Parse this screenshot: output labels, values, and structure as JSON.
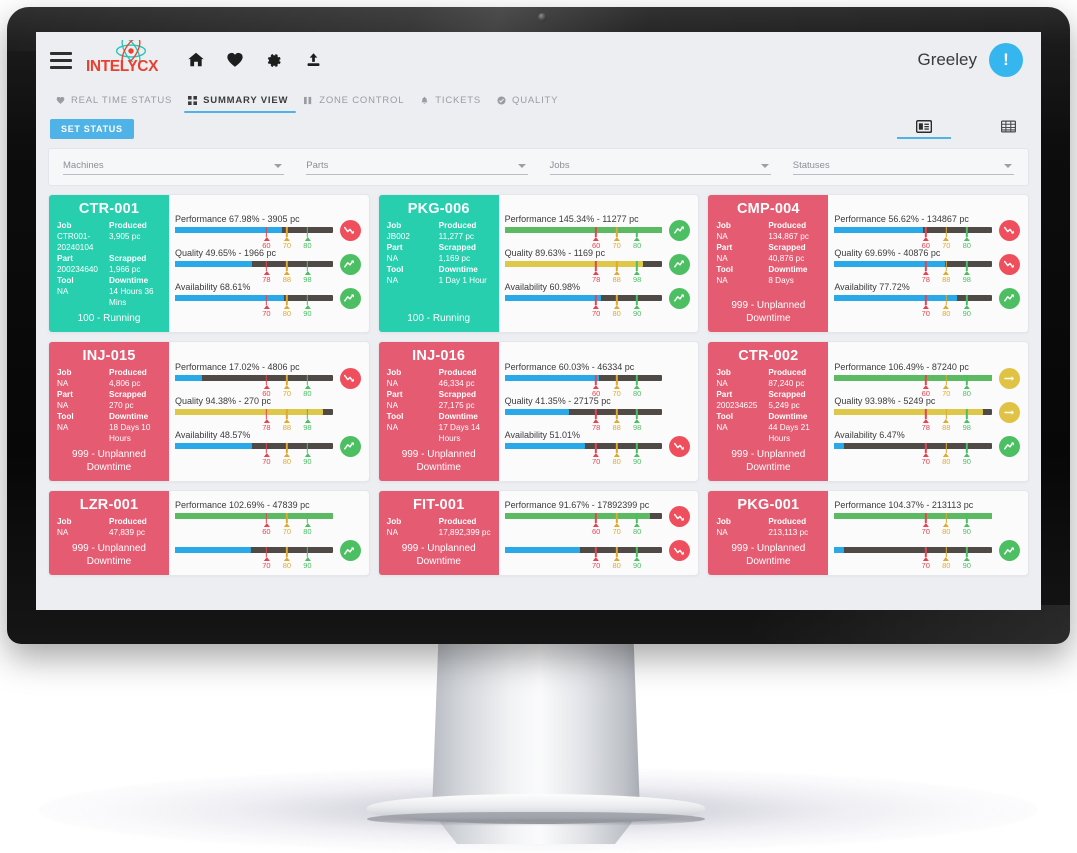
{
  "app": {
    "logo_text": "INTELYCX",
    "user": "Greeley",
    "avatar_glyph": "!",
    "hamburger_icon": "hamburger-menu-icon",
    "nav_icons": [
      {
        "name": "home-icon",
        "glyph": "⌂"
      },
      {
        "name": "heart-icon",
        "glyph": "♥"
      },
      {
        "name": "gear-icon",
        "glyph": "⚙"
      },
      {
        "name": "upload-icon",
        "glyph": "⇧"
      }
    ]
  },
  "tabs": [
    {
      "label": "REAL TIME STATUS",
      "icon": "heart-icon",
      "active": false
    },
    {
      "label": "SUMMARY VIEW",
      "icon": "grid-squares-icon",
      "active": true
    },
    {
      "label": "ZONE CONTROL",
      "icon": "columns-icon",
      "active": false
    },
    {
      "label": "TICKETS",
      "icon": "bell-icon",
      "active": false
    },
    {
      "label": "QUALITY",
      "icon": "check-circle-icon",
      "active": false
    }
  ],
  "subbar": {
    "set_status_label": "SET STATUS",
    "view_toggles": [
      {
        "name": "card-view-icon",
        "active": true
      },
      {
        "name": "table-view-icon",
        "active": false
      }
    ]
  },
  "filters": [
    {
      "label": "Machines",
      "value": ""
    },
    {
      "label": "Parts",
      "value": ""
    },
    {
      "label": "Jobs",
      "value": ""
    },
    {
      "label": "Statuses",
      "value": ""
    }
  ],
  "colors": {
    "accent": "#4fb3e8",
    "running": "#27cfae",
    "downtime": "#e45b72",
    "bar_blue": "#29a9e8",
    "bar_green": "#5bba62",
    "bar_yellow": "#ddc84a",
    "bar_track": "#4f4a46",
    "badge_red": "#ef4f5c",
    "badge_green": "#4cbf63",
    "badge_amber": "#e0c345",
    "tick_red": "#e8434f",
    "tick_amber": "#e0a92f",
    "tick_green": "#4cbf63"
  },
  "labels": {
    "job": "Job",
    "produced": "Produced",
    "part": "Part",
    "scrapped": "Scrapped",
    "tool": "Tool",
    "downtime": "Downtime"
  },
  "cards": [
    {
      "machine": "CTR-001",
      "state": "running",
      "status": "100 - Running",
      "job": "CTR001-20240104",
      "produced": "3,905 pc",
      "part": "200234640",
      "scrapped": "1,966 pc",
      "tool": "NA",
      "downtime_value": "14 Hours 36 Mins",
      "metrics": [
        {
          "title": "Performance 67.98% - 3905 pc",
          "pct": 68,
          "fill": "blue",
          "ticks": [
            60,
            70,
            80
          ],
          "badge": "red",
          "trend": "down"
        },
        {
          "title": "Quality 49.65% - 1966 pc",
          "pct": 49,
          "fill": "blue",
          "ticks": [
            78,
            88,
            98
          ],
          "badge": "green",
          "trend": "up"
        },
        {
          "title": "Availability 68.61%",
          "pct": 69,
          "fill": "blue",
          "ticks": [
            70,
            80,
            90
          ],
          "badge": "green",
          "trend": "up"
        }
      ]
    },
    {
      "machine": "PKG-006",
      "state": "running",
      "status": "100 - Running",
      "job": "JB002",
      "produced": "11,277 pc",
      "part": "NA",
      "scrapped": "1,169 pc",
      "tool": "NA",
      "downtime_value": "1 Day 1 Hour",
      "metrics": [
        {
          "title": "Performance 145.34% - 11277 pc",
          "pct": 100,
          "fill": "green",
          "ticks": [
            60,
            70,
            80
          ],
          "badge": "green",
          "trend": "up"
        },
        {
          "title": "Quality 89.63% - 1169 pc",
          "pct": 88,
          "fill": "yellow",
          "ticks": [
            78,
            88,
            98
          ],
          "badge": "green",
          "trend": "up"
        },
        {
          "title": "Availability 60.98%",
          "pct": 61,
          "fill": "blue",
          "ticks": [
            70,
            80,
            90
          ],
          "badge": "green",
          "trend": "up"
        }
      ]
    },
    {
      "machine": "CMP-004",
      "state": "down",
      "status": "999 - Unplanned Downtime",
      "job": "NA",
      "produced": "134,867 pc",
      "part": "NA",
      "scrapped": "40,876 pc",
      "tool": "NA",
      "downtime_value": "8 Days",
      "metrics": [
        {
          "title": "Performance 56.62% - 134867 pc",
          "pct": 56,
          "fill": "blue",
          "ticks": [
            60,
            70,
            80
          ],
          "badge": "red",
          "trend": "down"
        },
        {
          "title": "Quality 69.69% - 40876 pc",
          "pct": 70,
          "fill": "blue",
          "ticks": [
            78,
            88,
            98
          ],
          "badge": "red",
          "trend": "down"
        },
        {
          "title": "Availability 77.72%",
          "pct": 78,
          "fill": "blue",
          "ticks": [
            70,
            80,
            90
          ],
          "badge": "green",
          "trend": "up"
        }
      ]
    },
    {
      "machine": "INJ-015",
      "state": "down",
      "status": "999 - Unplanned Downtime",
      "job": "NA",
      "produced": "4,806 pc",
      "part": "NA",
      "scrapped": "270 pc",
      "tool": "NA",
      "downtime_value": "18 Days 10 Hours",
      "metrics": [
        {
          "title": "Performance 17.02% - 4806 pc",
          "pct": 17,
          "fill": "blue",
          "ticks": [
            60,
            70,
            80
          ],
          "badge": "red",
          "trend": "down"
        },
        {
          "title": "Quality 94.38% - 270 pc",
          "pct": 94,
          "fill": "yellow",
          "ticks": [
            78,
            88,
            98
          ],
          "badge": "none",
          "trend": "none"
        },
        {
          "title": "Availability 48.57%",
          "pct": 49,
          "fill": "blue",
          "ticks": [
            70,
            80,
            90
          ],
          "badge": "green",
          "trend": "up"
        }
      ]
    },
    {
      "machine": "INJ-016",
      "state": "down",
      "status": "999 - Unplanned Downtime",
      "job": "NA",
      "produced": "46,334 pc",
      "part": "NA",
      "scrapped": "27,175 pc",
      "tool": "NA",
      "downtime_value": "17 Days 14 Hours",
      "metrics": [
        {
          "title": "Performance 60.03% - 46334 pc",
          "pct": 60,
          "fill": "blue",
          "ticks": [
            60,
            70,
            80
          ],
          "badge": "none",
          "trend": "none"
        },
        {
          "title": "Quality 41.35% - 27175 pc",
          "pct": 41,
          "fill": "blue",
          "ticks": [
            78,
            88,
            98
          ],
          "badge": "none",
          "trend": "none"
        },
        {
          "title": "Availability 51.01%",
          "pct": 51,
          "fill": "blue",
          "ticks": [
            70,
            80,
            90
          ],
          "badge": "red",
          "trend": "down"
        }
      ]
    },
    {
      "machine": "CTR-002",
      "state": "down",
      "status": "999 - Unplanned Downtime",
      "job": "NA",
      "produced": "87,240 pc",
      "part": "200234625",
      "scrapped": "5,249 pc",
      "tool": "NA",
      "downtime_value": "44 Days 21 Hours",
      "metrics": [
        {
          "title": "Performance 106.49% - 87240 pc",
          "pct": 100,
          "fill": "green",
          "ticks": [
            60,
            70,
            80
          ],
          "badge": "amber",
          "trend": "flat"
        },
        {
          "title": "Quality 93.98% - 5249 pc",
          "pct": 94,
          "fill": "yellow",
          "ticks": [
            78,
            88,
            98
          ],
          "badge": "amber",
          "trend": "flat"
        },
        {
          "title": "Availability 6.47%",
          "pct": 6,
          "fill": "blue",
          "ticks": [
            70,
            80,
            90
          ],
          "badge": "green",
          "trend": "up"
        }
      ]
    },
    {
      "machine": "LZR-001",
      "state": "down",
      "status": "999 - Unplanned Downtime",
      "job": "NA",
      "produced": "47,839 pc",
      "compact": true,
      "metrics": [
        {
          "title": "Performance 102.69% - 47839 pc",
          "pct": 100,
          "fill": "green",
          "ticks": [
            60,
            70,
            80
          ],
          "badge": "none",
          "trend": "none"
        },
        {
          "title": "",
          "pct": 48,
          "fill": "blue",
          "ticks": [
            70,
            80,
            90
          ],
          "badge": "green",
          "trend": "up"
        }
      ]
    },
    {
      "machine": "FIT-001",
      "state": "down",
      "status": "999 - Unplanned Downtime",
      "job": "NA",
      "produced": "17,892,399 pc",
      "compact": true,
      "metrics": [
        {
          "title": "Performance 91.67% - 17892399 pc",
          "pct": 92,
          "fill": "green",
          "ticks": [
            60,
            70,
            80
          ],
          "badge": "red",
          "trend": "down"
        },
        {
          "title": "",
          "pct": 48,
          "fill": "blue",
          "ticks": [
            70,
            80,
            90
          ],
          "badge": "red",
          "trend": "down"
        }
      ]
    },
    {
      "machine": "PKG-001",
      "state": "down",
      "status": "999 - Unplanned Downtime",
      "job": "NA",
      "produced": "213,113 pc",
      "compact": true,
      "metrics": [
        {
          "title": "Performance 104.37% - 213113 pc",
          "pct": 100,
          "fill": "green",
          "ticks": [
            70,
            80,
            90
          ],
          "badge": "none",
          "trend": "none"
        },
        {
          "title": "",
          "pct": 6,
          "fill": "blue",
          "ticks": [
            70,
            80,
            90
          ],
          "badge": "green",
          "trend": "up"
        }
      ]
    }
  ]
}
